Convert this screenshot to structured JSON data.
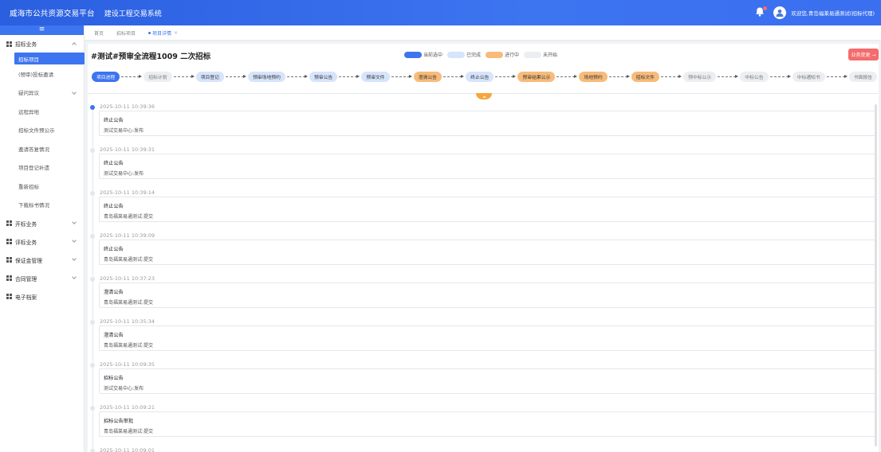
{
  "topbar": {
    "platform_title": "威海市公共资源交易平台",
    "system_title": "建设工程交易系统",
    "user_text": "欢迎您,青岛福莱易通测试(招标代理)",
    "accent": "#3d74f0"
  },
  "sidebar": {
    "toggle": "≡",
    "groups": [
      {
        "label": "招标业务"
      },
      {
        "label": "开标业务"
      },
      {
        "label": "评标业务"
      },
      {
        "label": "保证金管理"
      },
      {
        "label": "合同管理"
      },
      {
        "label": "电子档案"
      }
    ],
    "items": [
      {
        "label": "招标项目"
      },
      {
        "label": "(预审)投标邀请"
      },
      {
        "label": "疑问异议"
      },
      {
        "label": "远程异地"
      },
      {
        "label": "招标文件预公示"
      },
      {
        "label": "邀请答复情况"
      },
      {
        "label": "项目登记补遗"
      },
      {
        "label": "重新招标"
      },
      {
        "label": "下载标书情况"
      }
    ]
  },
  "tabs": [
    {
      "label": "首页"
    },
    {
      "label": "招标项目"
    },
    {
      "label": "项目详情"
    }
  ],
  "main": {
    "project_title": "#测试#预审全流程1009 二次招标",
    "change_button": "业务变更 →",
    "legend": [
      {
        "label": "当前选中",
        "color": "#3d74f0"
      },
      {
        "label": "已完成",
        "color": "#d6e4fc"
      },
      {
        "label": "进行中",
        "color": "#f7bb7a"
      },
      {
        "label": "未开始",
        "color": "#eceef2"
      }
    ],
    "flow": [
      {
        "label": "项目进程",
        "state": "current"
      },
      {
        "label": "招标计划",
        "state": "pending"
      },
      {
        "label": "项目登记",
        "state": "done"
      },
      {
        "label": "预审场地预约",
        "state": "done"
      },
      {
        "label": "预审公告",
        "state": "done"
      },
      {
        "label": "预审文件",
        "state": "done"
      },
      {
        "label": "澄清公告",
        "state": "progress"
      },
      {
        "label": "终止公告",
        "state": "done"
      },
      {
        "label": "预审结果公示",
        "state": "progress"
      },
      {
        "label": "场地预约",
        "state": "progress"
      },
      {
        "label": "招标文件",
        "state": "progress"
      },
      {
        "label": "预中标公示",
        "state": "pending"
      },
      {
        "label": "中标公告",
        "state": "pending"
      },
      {
        "label": "中标通知书",
        "state": "pending"
      },
      {
        "label": "书面报告",
        "state": "pending"
      }
    ]
  },
  "timeline": [
    {
      "time": "2025-10-11 10:39:36",
      "title": "终止公告",
      "sub": "测试交易中心:发布"
    },
    {
      "time": "2025-10-11 10:39:31",
      "title": "终止公告",
      "sub": "测试交易中心:发布"
    },
    {
      "time": "2025-10-11 10:39:14",
      "title": "终止公告",
      "sub": "青岛福莱易通测试:提交"
    },
    {
      "time": "2025-10-11 10:39:09",
      "title": "终止公告",
      "sub": "青岛福莱易通测试:提交"
    },
    {
      "time": "2025-10-11 10:37:23",
      "title": "澄清公告",
      "sub": "青岛福莱易通测试:提交"
    },
    {
      "time": "2025-10-11 10:35:34",
      "title": "澄清公告",
      "sub": "青岛福莱易通测试:提交"
    },
    {
      "time": "2025-10-11 10:09:35",
      "title": "招标公告",
      "sub": "测试交易中心:发布"
    },
    {
      "time": "2025-10-11 10:09:21",
      "title": "招标公告审批",
      "sub": "青岛福莱易通测试:提交"
    },
    {
      "time": "2025-10-11 10:09:01",
      "title": "",
      "sub": ""
    }
  ]
}
